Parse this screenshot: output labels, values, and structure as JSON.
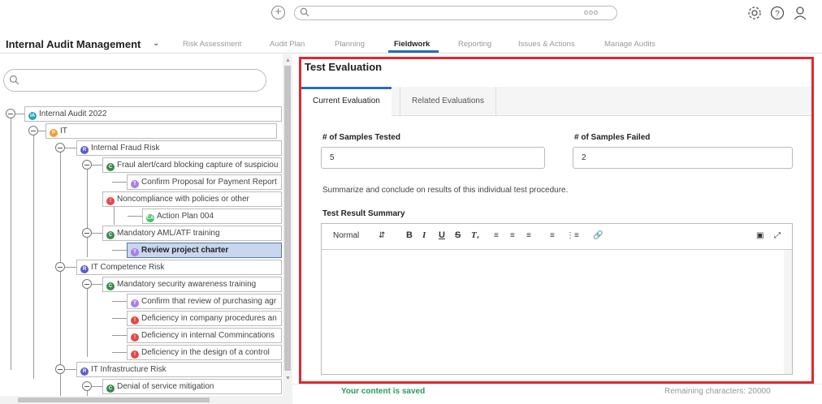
{
  "topbar": {
    "add_icon": "plus-circle-icon",
    "search_icon": "search-icon",
    "more_icon": "ellipsis-icon",
    "settings_icon": "gear-icon",
    "help_icon": "question-icon",
    "user_icon": "user-icon"
  },
  "nav": {
    "app_name": "Internal Audit Management",
    "tabs": [
      "Risk Assessment",
      "Audit Plan",
      "Planning",
      "Fieldwork",
      "Reporting",
      "Issues & Actions",
      "Manage Audits"
    ],
    "active_tab": "Fieldwork"
  },
  "tree": {
    "nodes": [
      {
        "label": "Internal Audit 2022",
        "badge": "IA",
        "color": "#29a3b8"
      },
      {
        "label": "IT",
        "badge": "P",
        "color": "#f0a030"
      },
      {
        "label": "Internal Fraud Risk",
        "badge": "R",
        "color": "#5561c9"
      },
      {
        "label": "Fraul alert/card blocking capture of suspiciou",
        "badge": "C",
        "color": "#3a8a4a"
      },
      {
        "label": "Confirm Proposal for Payment Report",
        "badge": "T",
        "color": "#a980e8"
      },
      {
        "label": "Noncompliance with policies or other",
        "badge": "!",
        "color": "#e54848"
      },
      {
        "label": "Action Plan 004",
        "badge": "CA",
        "color": "#46c06a"
      },
      {
        "label": "Mandatory AML/ATF training",
        "badge": "C",
        "color": "#3a8a4a"
      },
      {
        "label": "Review project charter",
        "badge": "T",
        "color": "#a980e8"
      },
      {
        "label": "IT Competence Risk",
        "badge": "R",
        "color": "#5561c9"
      },
      {
        "label": "Mandatory security awareness training",
        "badge": "C",
        "color": "#3a8a4a"
      },
      {
        "label": "Confirm that review of purchasing agr",
        "badge": "T",
        "color": "#a980e8"
      },
      {
        "label": "Deficiency in company procedures an",
        "badge": "!",
        "color": "#e54848"
      },
      {
        "label": "Deficiency in internal Commincations",
        "badge": "!",
        "color": "#e54848"
      },
      {
        "label": "Deficiency in the design of a control",
        "badge": "!",
        "color": "#e54848"
      },
      {
        "label": "IT Infrastructure Risk",
        "badge": "R",
        "color": "#5561c9"
      },
      {
        "label": "Denial of service mitigation",
        "badge": "C",
        "color": "#3a8a4a"
      }
    ]
  },
  "panel": {
    "title": "Test Evaluation",
    "tabs": [
      "Current Evaluation",
      "Related Evaluations"
    ],
    "samples_tested_label": "# of Samples Tested",
    "samples_tested_value": "5",
    "samples_failed_label": "# of Samples Failed",
    "samples_failed_value": "2",
    "description": "Summarize and conclude on results of this individual test procedure.",
    "summary_label": "Test Result Summary",
    "editor": {
      "format_select": "Normal",
      "buttons": [
        "bold-icon",
        "italic-icon",
        "underline-icon",
        "strikethrough-icon",
        "clear-format-icon",
        "align-left-icon",
        "align-center-icon",
        "align-right-icon",
        "bullet-list-icon",
        "numbered-list-icon",
        "link-icon",
        "save-icon",
        "expand-icon"
      ]
    },
    "saved_status": "Your content is saved",
    "remaining": "Remaining characters: 20000"
  },
  "colors": {
    "accent": "#2b6cb0",
    "highlight_border": "#e0282e",
    "saved_green": "#2c9a5c"
  }
}
